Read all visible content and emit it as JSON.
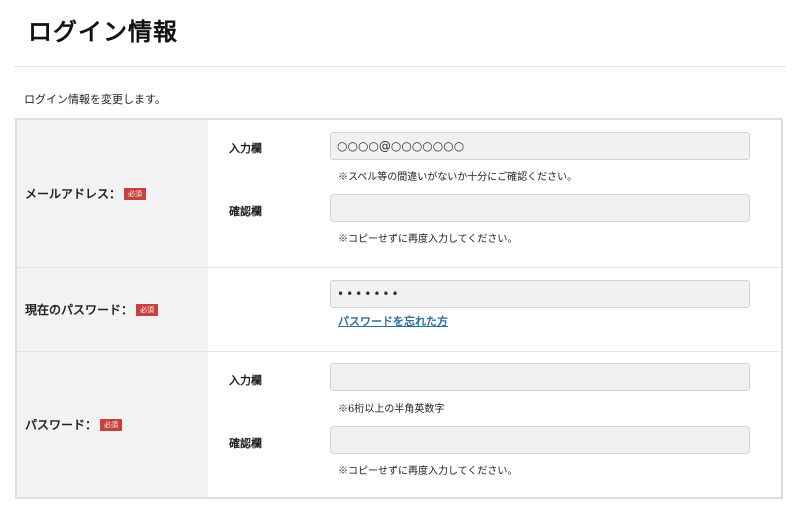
{
  "header": {
    "title": "ログイン情報"
  },
  "intro": "ログイン情報を変更します。",
  "required_badge": "必須",
  "email": {
    "label": "メールアドレス：",
    "input_label": "入力欄",
    "input_value": "○○○○@○○○○○○○",
    "input_note": "※スペル等の間違いがないか十分にご確認ください。",
    "confirm_label": "確認欄",
    "confirm_value": "",
    "confirm_note": "※コピーせずに再度入力してください。"
  },
  "current_password": {
    "label": "現在のパスワード：",
    "value": "•••••••",
    "forgot_link": "パスワードを忘れた方"
  },
  "password": {
    "label": "パスワード：",
    "input_label": "入力欄",
    "input_value": "",
    "input_note": "※6桁以上の半角英数字",
    "confirm_label": "確認欄",
    "confirm_value": "",
    "confirm_note": "※コピーせずに再度入力してください。"
  }
}
